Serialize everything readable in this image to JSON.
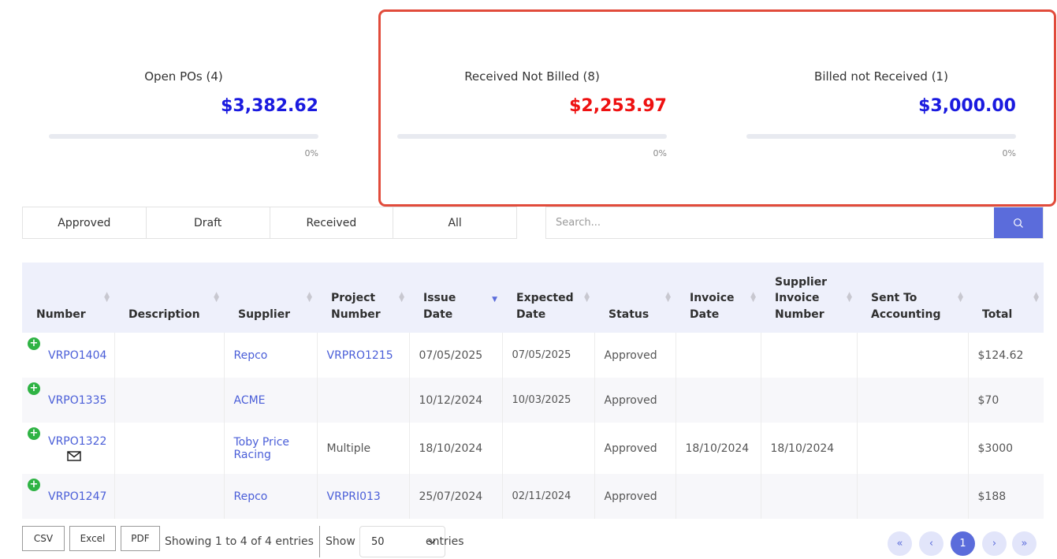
{
  "cards": [
    {
      "title": "Open POs (4)",
      "amount": "$3,382.62",
      "progress_percent": 0,
      "progress_label": "0%",
      "amount_color": "#1a1adf"
    },
    {
      "title": "Received Not Billed (8)",
      "amount": "$2,253.97",
      "progress_percent": 0,
      "progress_label": "0%",
      "amount_color": "#ee1111"
    },
    {
      "title": "Billed not Received (1)",
      "amount": "$3,000.00",
      "progress_percent": 0,
      "progress_label": "0%",
      "amount_color": "#1a1adf"
    }
  ],
  "tabs": [
    "Approved",
    "Draft",
    "Received",
    "All"
  ],
  "search": {
    "placeholder": "Search...",
    "value": "",
    "icon": "search-icon"
  },
  "table": {
    "headers": {
      "number": "Number",
      "description": "Description",
      "supplier": "Supplier",
      "project_number_1": "Project",
      "project_number_2": "Number",
      "issue_date_1": "Issue",
      "issue_date_2": "Date",
      "expected_date_1": "Expected",
      "expected_date_2": "Date",
      "status": "Status",
      "invoice_date_1": "Invoice",
      "invoice_date_2": "Date",
      "supplier_invoice_1": "Supplier",
      "supplier_invoice_2": "Invoice",
      "supplier_invoice_3": "Number",
      "sent_to_accounting_1": "Sent To",
      "sent_to_accounting_2": "Accounting",
      "total": "Total"
    },
    "sorted_column": "Issue Date",
    "rows": [
      {
        "number": "VRPO1404",
        "description": "",
        "supplier_1": "Repco",
        "supplier_2": "",
        "project_number": "VRPRO1215",
        "issue_date": "07/05/2025",
        "expected_date": "07/05/2025",
        "status": "Approved",
        "invoice_date": "",
        "supplier_invoice_number": "",
        "sent_to_accounting": "",
        "total": "$124.62"
      },
      {
        "number": "VRPO1335",
        "description": "",
        "supplier_1": "ACME",
        "supplier_2": "",
        "project_number": "",
        "issue_date": "10/12/2024",
        "expected_date": "10/03/2025",
        "status": "Approved",
        "invoice_date": "",
        "supplier_invoice_number": "",
        "sent_to_accounting": "",
        "total": "$70"
      },
      {
        "number": "VRPO1322",
        "description": "",
        "supplier_1": "Toby Price",
        "supplier_2": "Racing",
        "project_number": "Multiple",
        "issue_date": "18/10/2024",
        "expected_date": "",
        "status": "Approved",
        "invoice_date": "18/10/2024",
        "supplier_invoice_number": "18/10/2024",
        "sent_to_accounting": "",
        "total": "$3000"
      },
      {
        "number": "VRPO1247",
        "description": "",
        "supplier_1": "Repco",
        "supplier_2": "",
        "project_number": "VRPRI013",
        "issue_date": "25/07/2024",
        "expected_date": "02/11/2024",
        "status": "Approved",
        "invoice_date": "",
        "supplier_invoice_number": "",
        "sent_to_accounting": "",
        "total": "$188"
      }
    ]
  },
  "footer": {
    "export_buttons": [
      "CSV",
      "Excel",
      "PDF"
    ],
    "info": "Showing 1 to 4 of 4 entries",
    "show_label": "Show",
    "page_size": "50",
    "entries_label": "entries"
  },
  "pagination": {
    "first": "«",
    "prev": "‹",
    "current": "1",
    "next": "›",
    "last": "»"
  },
  "colors": {
    "accent": "#5b6cdb",
    "highlight": "#e14b3b",
    "link": "#4a5ed8",
    "add_green": "#2fb344"
  }
}
